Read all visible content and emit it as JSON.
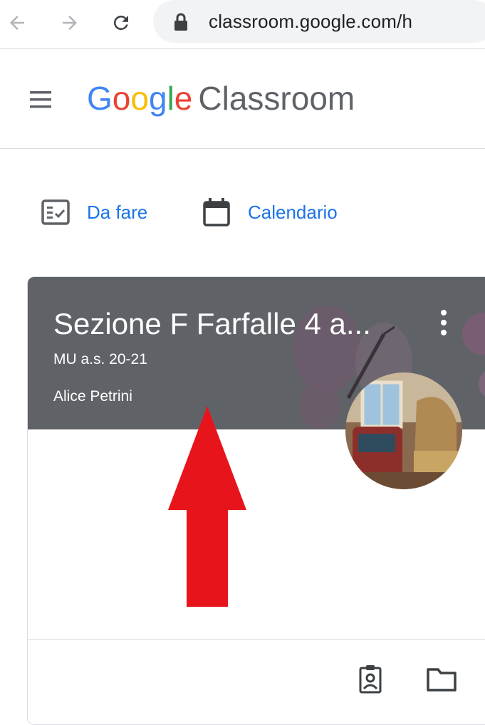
{
  "browser": {
    "url": "classroom.google.com/h",
    "icons": [
      "back-arrow-icon",
      "forward-arrow-icon",
      "reload-icon",
      "lock-icon"
    ]
  },
  "header": {
    "menu_icon": "hamburger-menu-icon",
    "brand_letters": [
      "G",
      "o",
      "o",
      "g",
      "l",
      "e"
    ],
    "brand_colors": [
      "#4285F4",
      "#EA4335",
      "#FBBC05",
      "#4285F4",
      "#34A853",
      "#EA4335"
    ],
    "product": "Classroom"
  },
  "links": {
    "todo": {
      "label": "Da fare",
      "icon": "todo-list-icon"
    },
    "calendar": {
      "label": "Calendario",
      "icon": "calendar-icon"
    }
  },
  "class_card": {
    "title": "Sezione F Farfalle 4 a...",
    "section": "MU a.s. 20-21",
    "teacher": "Alice Petrini",
    "menu_icon": "more-vert-icon",
    "avatar": "teacher-avatar",
    "footer_icons": [
      "assignment-ind-icon",
      "folder-icon"
    ]
  },
  "colors": {
    "link": "#1a73e8",
    "banner": "#5f6368",
    "annotation_arrow": "#e8141b"
  }
}
